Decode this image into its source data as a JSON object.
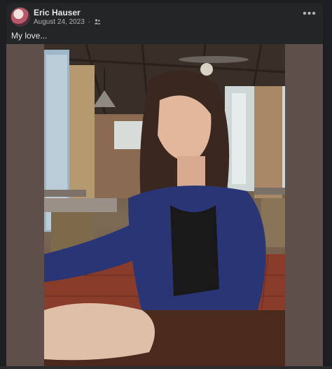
{
  "post": {
    "author": "Eric Hauser",
    "date": "August 24, 2023",
    "separator": "·",
    "audience_icon": "friends-icon",
    "more_label": "•••",
    "caption": "My love...",
    "photo_alt": "Photo of a woman smiling at a café table"
  },
  "colors": {
    "background": "#1c1e21",
    "card": "#242526",
    "text_primary": "#e4e6eb",
    "text_secondary": "#b0b3b8",
    "photo_matte": "#5e4f4b"
  }
}
